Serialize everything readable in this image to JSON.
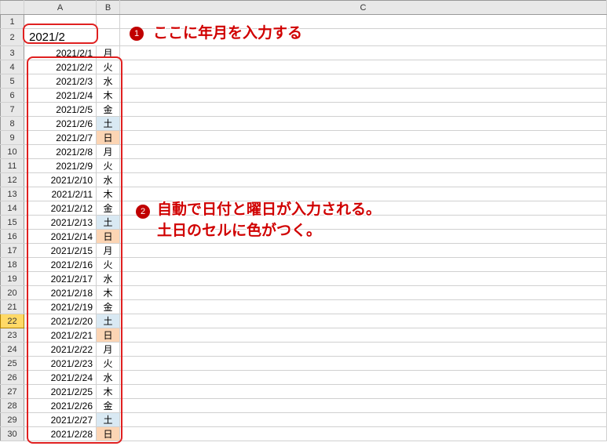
{
  "columns": {
    "A": "A",
    "B": "B",
    "C": "C"
  },
  "input_value": "2021/2",
  "rows": [
    {
      "n": 1,
      "date": "",
      "dow": ""
    },
    {
      "n": 2,
      "date": "",
      "dow": "",
      "input": true
    },
    {
      "n": 3,
      "date": "2021/2/1",
      "dow": "月"
    },
    {
      "n": 4,
      "date": "2021/2/2",
      "dow": "火"
    },
    {
      "n": 5,
      "date": "2021/2/3",
      "dow": "水"
    },
    {
      "n": 6,
      "date": "2021/2/4",
      "dow": "木"
    },
    {
      "n": 7,
      "date": "2021/2/5",
      "dow": "金"
    },
    {
      "n": 8,
      "date": "2021/2/6",
      "dow": "土",
      "cls": "sat"
    },
    {
      "n": 9,
      "date": "2021/2/7",
      "dow": "日",
      "cls": "sun"
    },
    {
      "n": 10,
      "date": "2021/2/8",
      "dow": "月"
    },
    {
      "n": 11,
      "date": "2021/2/9",
      "dow": "火"
    },
    {
      "n": 12,
      "date": "2021/2/10",
      "dow": "水"
    },
    {
      "n": 13,
      "date": "2021/2/11",
      "dow": "木"
    },
    {
      "n": 14,
      "date": "2021/2/12",
      "dow": "金"
    },
    {
      "n": 15,
      "date": "2021/2/13",
      "dow": "土",
      "cls": "sat"
    },
    {
      "n": 16,
      "date": "2021/2/14",
      "dow": "日",
      "cls": "sun"
    },
    {
      "n": 17,
      "date": "2021/2/15",
      "dow": "月"
    },
    {
      "n": 18,
      "date": "2021/2/16",
      "dow": "火"
    },
    {
      "n": 19,
      "date": "2021/2/17",
      "dow": "水"
    },
    {
      "n": 20,
      "date": "2021/2/18",
      "dow": "木"
    },
    {
      "n": 21,
      "date": "2021/2/19",
      "dow": "金"
    },
    {
      "n": 22,
      "date": "2021/2/20",
      "dow": "土",
      "cls": "sat",
      "sel": true
    },
    {
      "n": 23,
      "date": "2021/2/21",
      "dow": "日",
      "cls": "sun"
    },
    {
      "n": 24,
      "date": "2021/2/22",
      "dow": "月"
    },
    {
      "n": 25,
      "date": "2021/2/23",
      "dow": "火"
    },
    {
      "n": 26,
      "date": "2021/2/24",
      "dow": "水"
    },
    {
      "n": 27,
      "date": "2021/2/25",
      "dow": "木"
    },
    {
      "n": 28,
      "date": "2021/2/26",
      "dow": "金"
    },
    {
      "n": 29,
      "date": "2021/2/27",
      "dow": "土",
      "cls": "sat"
    },
    {
      "n": 30,
      "date": "2021/2/28",
      "dow": "日",
      "cls": "sun"
    }
  ],
  "annotations": {
    "badge1": "1",
    "badge2": "2",
    "callout1": "ここに年月を入力する",
    "callout2a": "自動で日付と曜日が入力される。",
    "callout2b": "土日のセルに色がつく。"
  }
}
